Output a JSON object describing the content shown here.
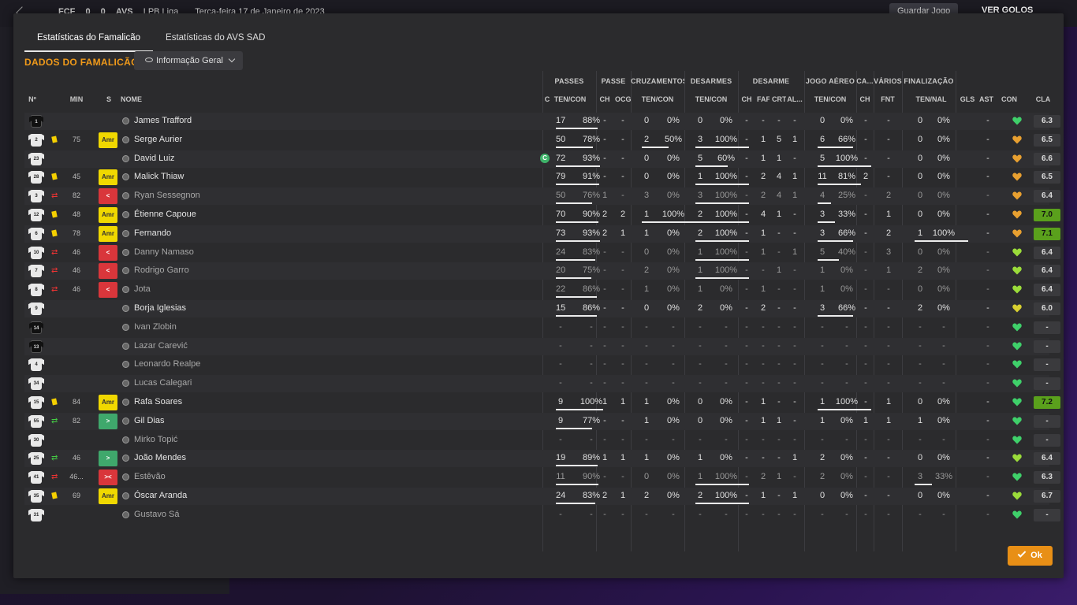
{
  "topbar": {
    "home": "FCF",
    "score_home": "0",
    "score_away": "0",
    "away": "AVS",
    "competition": "LPB Liga",
    "date": "Terça-feira 17 de Janeiro de 2023",
    "save_label": "Guardar Jogo",
    "goals_label": "VER GOLOS"
  },
  "tabs": [
    {
      "label": "Estatísticas do Famalicão"
    },
    {
      "label": "Estatísticas do AVS SAD"
    }
  ],
  "section_title": "DADOS DO FAMALICÃO",
  "view_dropdown": "Informação Geral",
  "groups": [
    "PASSES",
    "PASSE",
    "CRUZAMENTOS",
    "DESARMES",
    "DESARME",
    "JOGO AÉREO",
    "CA...",
    "VÁRIOS",
    "FINALIZAÇÃO"
  ],
  "headers": [
    "Nº",
    "MIN",
    "S",
    "NOME",
    "C",
    "TEN/CON",
    "CH",
    "OCG",
    "TEN/CON",
    "TEN/CON",
    "CH",
    "FAF",
    "CRT",
    "AL...",
    "TEN/CON",
    "CH",
    "FNT",
    "TEN/NAL",
    "GLS",
    "AST",
    "CON",
    "CLA"
  ],
  "players": [
    {
      "num": "1",
      "gk": true,
      "min": "",
      "yellow": false,
      "sub": "",
      "badge": "",
      "badge_label": "",
      "name": "James Trafford",
      "dim": false,
      "captain": false,
      "c": [
        "17",
        "88%",
        "-",
        "-",
        "0",
        "0%",
        "0",
        "0%",
        "-",
        "-",
        "-",
        "-",
        "0",
        "0%",
        "-",
        "-",
        "0",
        "0%",
        "-"
      ],
      "con": "green",
      "cla": "6.3",
      "good": false,
      "pass_ratio": 0.88,
      "cross_ratio": 0,
      "tack_ratio": 0,
      "air_ratio": 0,
      "fin_ratio": 0
    },
    {
      "num": "2",
      "gk": false,
      "min": "75",
      "yellow": true,
      "sub": "",
      "badge": "amr",
      "badge_label": "Amr",
      "name": "Serge Aurier",
      "dim": false,
      "captain": false,
      "c": [
        "50",
        "78%",
        "-",
        "-",
        "2",
        "50%",
        "3",
        "100%",
        "-",
        "1",
        "5",
        "1",
        "6",
        "66%",
        "-",
        "-",
        "0",
        "0%",
        "-"
      ],
      "con": "orange",
      "cla": "6.5",
      "good": false,
      "pass_ratio": 0.78,
      "cross_ratio": 0.5,
      "tack_ratio": 1,
      "air_ratio": 0.66,
      "fin_ratio": 0
    },
    {
      "num": "23",
      "gk": false,
      "min": "",
      "yellow": false,
      "sub": "",
      "badge": "",
      "badge_label": "",
      "name": "David Luiz",
      "dim": false,
      "captain": true,
      "captain_label": "C",
      "c": [
        "72",
        "93%",
        "-",
        "-",
        "0",
        "0%",
        "5",
        "60%",
        "-",
        "1",
        "1",
        "-",
        "5",
        "100%",
        "-",
        "-",
        "0",
        "0%",
        "-"
      ],
      "con": "orange",
      "cla": "6.6",
      "good": false,
      "pass_ratio": 0.93,
      "cross_ratio": 0,
      "tack_ratio": 0.6,
      "air_ratio": 1,
      "fin_ratio": 0
    },
    {
      "num": "28",
      "gk": false,
      "min": "45",
      "yellow": true,
      "sub": "",
      "badge": "amr",
      "badge_label": "Amr",
      "name": "Malick Thiaw",
      "dim": false,
      "captain": false,
      "c": [
        "79",
        "91%",
        "-",
        "-",
        "0",
        "0%",
        "1",
        "100%",
        "-",
        "2",
        "4",
        "1",
        "11",
        "81%",
        "2",
        "-",
        "0",
        "0%",
        "-"
      ],
      "con": "orange",
      "cla": "6.5",
      "good": false,
      "pass_ratio": 0.91,
      "cross_ratio": 0,
      "tack_ratio": 1,
      "air_ratio": 0.81,
      "fin_ratio": 0
    },
    {
      "num": "3",
      "gk": false,
      "min": "82",
      "yellow": false,
      "sub": "out",
      "badge": "out",
      "badge_label": "<",
      "name": "Ryan Sessegnon",
      "dim": true,
      "captain": false,
      "c": [
        "50",
        "76%",
        "1",
        "-",
        "3",
        "0%",
        "3",
        "100%",
        "-",
        "2",
        "4",
        "1",
        "4",
        "25%",
        "-",
        "2",
        "0",
        "0%",
        "-"
      ],
      "con": "orange",
      "cla": "6.4",
      "good": false,
      "pass_ratio": 0.76,
      "cross_ratio": 0,
      "tack_ratio": 1,
      "air_ratio": 0.25,
      "fin_ratio": 0
    },
    {
      "num": "12",
      "gk": false,
      "min": "48",
      "yellow": true,
      "sub": "",
      "badge": "amr",
      "badge_label": "Amr",
      "name": "Étienne Capoue",
      "dim": false,
      "captain": false,
      "c": [
        "70",
        "90%",
        "2",
        "2",
        "1",
        "100%",
        "2",
        "100%",
        "-",
        "4",
        "1",
        "-",
        "3",
        "33%",
        "-",
        "1",
        "0",
        "0%",
        "-"
      ],
      "con": "orange",
      "cla": "7.0",
      "good": true,
      "pass_ratio": 0.9,
      "cross_ratio": 1,
      "tack_ratio": 1,
      "air_ratio": 0.33,
      "fin_ratio": 0
    },
    {
      "num": "6",
      "gk": false,
      "min": "78",
      "yellow": true,
      "sub": "",
      "badge": "amr",
      "badge_label": "Amr",
      "name": "Fernando",
      "dim": false,
      "captain": false,
      "c": [
        "73",
        "93%",
        "2",
        "1",
        "1",
        "0%",
        "2",
        "100%",
        "-",
        "1",
        "-",
        "-",
        "3",
        "66%",
        "-",
        "2",
        "1",
        "100%",
        "-"
      ],
      "con": "orange",
      "cla": "7.1",
      "good": true,
      "pass_ratio": 0.93,
      "cross_ratio": 0,
      "tack_ratio": 1,
      "air_ratio": 0.66,
      "fin_ratio": 1
    },
    {
      "num": "10",
      "gk": false,
      "min": "46",
      "yellow": false,
      "sub": "out",
      "badge": "out",
      "badge_label": "<",
      "name": "Danny Namaso",
      "dim": true,
      "captain": false,
      "c": [
        "24",
        "83%",
        "-",
        "-",
        "0",
        "0%",
        "1",
        "100%",
        "-",
        "1",
        "-",
        "1",
        "5",
        "40%",
        "-",
        "3",
        "0",
        "0%",
        "-"
      ],
      "con": "lime",
      "cla": "6.4",
      "good": false,
      "pass_ratio": 0.83,
      "cross_ratio": 0,
      "tack_ratio": 1,
      "air_ratio": 0.4,
      "fin_ratio": 0
    },
    {
      "num": "7",
      "gk": false,
      "min": "46",
      "yellow": false,
      "sub": "out",
      "badge": "out",
      "badge_label": "<",
      "name": "Rodrigo Garro",
      "dim": true,
      "captain": false,
      "c": [
        "20",
        "75%",
        "-",
        "-",
        "2",
        "0%",
        "1",
        "100%",
        "-",
        "-",
        "1",
        "-",
        "1",
        "0%",
        "-",
        "1",
        "2",
        "0%",
        "-"
      ],
      "con": "lime",
      "cla": "6.4",
      "good": false,
      "pass_ratio": 0.75,
      "cross_ratio": 0,
      "tack_ratio": 1,
      "air_ratio": 0,
      "fin_ratio": 0
    },
    {
      "num": "8",
      "gk": false,
      "min": "46",
      "yellow": false,
      "sub": "out",
      "badge": "out",
      "badge_label": "<",
      "name": "Jota",
      "dim": true,
      "captain": false,
      "c": [
        "22",
        "86%",
        "-",
        "-",
        "1",
        "0%",
        "1",
        "0%",
        "-",
        "1",
        "-",
        "-",
        "1",
        "0%",
        "-",
        "-",
        "0",
        "0%",
        "-"
      ],
      "con": "lime",
      "cla": "6.4",
      "good": false,
      "pass_ratio": 0.86,
      "cross_ratio": 0,
      "tack_ratio": 0,
      "air_ratio": 0,
      "fin_ratio": 0
    },
    {
      "num": "9",
      "gk": false,
      "min": "",
      "yellow": false,
      "sub": "",
      "badge": "",
      "badge_label": "",
      "name": "Borja Iglesias",
      "dim": false,
      "captain": false,
      "c": [
        "15",
        "86%",
        "-",
        "-",
        "0",
        "0%",
        "2",
        "0%",
        "-",
        "2",
        "-",
        "-",
        "3",
        "66%",
        "-",
        "-",
        "2",
        "0%",
        "-"
      ],
      "con": "yellow",
      "cla": "6.0",
      "good": false,
      "pass_ratio": 0.86,
      "cross_ratio": 0,
      "tack_ratio": 0,
      "air_ratio": 0.66,
      "fin_ratio": 0
    },
    {
      "num": "14",
      "gk": true,
      "min": "",
      "yellow": false,
      "sub": "",
      "badge": "",
      "badge_label": "",
      "name": "Ivan Zlobin",
      "dim": true,
      "captain": false,
      "c": [
        "-",
        "-",
        "-",
        "-",
        "-",
        "-",
        "-",
        "-",
        "-",
        "-",
        "-",
        "-",
        "-",
        "-",
        "-",
        "-",
        "-",
        "-",
        "-"
      ],
      "con": "green",
      "cla": "-",
      "good": false,
      "pass_ratio": 0,
      "cross_ratio": 0,
      "tack_ratio": 0,
      "air_ratio": 0,
      "fin_ratio": 0
    },
    {
      "num": "13",
      "gk": true,
      "min": "",
      "yellow": false,
      "sub": "",
      "badge": "",
      "badge_label": "",
      "name": "Lazar Carević",
      "dim": true,
      "captain": false,
      "c": [
        "-",
        "-",
        "-",
        "-",
        "-",
        "-",
        "-",
        "-",
        "-",
        "-",
        "-",
        "-",
        "-",
        "-",
        "-",
        "-",
        "-",
        "-",
        "-"
      ],
      "con": "green",
      "cla": "-",
      "good": false,
      "pass_ratio": 0,
      "cross_ratio": 0,
      "tack_ratio": 0,
      "air_ratio": 0,
      "fin_ratio": 0
    },
    {
      "num": "4",
      "gk": false,
      "min": "",
      "yellow": false,
      "sub": "",
      "badge": "",
      "badge_label": "",
      "name": "Leonardo Realpe",
      "dim": true,
      "captain": false,
      "c": [
        "-",
        "-",
        "-",
        "-",
        "-",
        "-",
        "-",
        "-",
        "-",
        "-",
        "-",
        "-",
        "-",
        "-",
        "-",
        "-",
        "-",
        "-",
        "-"
      ],
      "con": "green",
      "cla": "-",
      "good": false,
      "pass_ratio": 0,
      "cross_ratio": 0,
      "tack_ratio": 0,
      "air_ratio": 0,
      "fin_ratio": 0
    },
    {
      "num": "34",
      "gk": false,
      "min": "",
      "yellow": false,
      "sub": "",
      "badge": "",
      "badge_label": "",
      "name": "Lucas Calegari",
      "dim": true,
      "captain": false,
      "c": [
        "-",
        "-",
        "-",
        "-",
        "-",
        "-",
        "-",
        "-",
        "-",
        "-",
        "-",
        "-",
        "-",
        "-",
        "-",
        "-",
        "-",
        "-",
        "-"
      ],
      "con": "green",
      "cla": "-",
      "good": false,
      "pass_ratio": 0,
      "cross_ratio": 0,
      "tack_ratio": 0,
      "air_ratio": 0,
      "fin_ratio": 0
    },
    {
      "num": "15",
      "gk": false,
      "min": "84",
      "yellow": true,
      "sub": "",
      "badge": "amr",
      "badge_label": "Amr",
      "name": "Rafa Soares",
      "dim": false,
      "captain": false,
      "c": [
        "9",
        "100%",
        "1",
        "1",
        "1",
        "0%",
        "0",
        "0%",
        "-",
        "1",
        "-",
        "-",
        "1",
        "100%",
        "-",
        "1",
        "0",
        "0%",
        "-"
      ],
      "con": "green",
      "cla": "7.2",
      "good": true,
      "pass_ratio": 1,
      "cross_ratio": 0,
      "tack_ratio": 0,
      "air_ratio": 1,
      "fin_ratio": 0
    },
    {
      "num": "55",
      "gk": false,
      "min": "82",
      "yellow": false,
      "sub": "in",
      "badge": "in",
      "badge_label": ">",
      "name": "Gil Dias",
      "dim": false,
      "captain": false,
      "c": [
        "9",
        "77%",
        "-",
        "-",
        "1",
        "0%",
        "0",
        "0%",
        "-",
        "1",
        "1",
        "-",
        "1",
        "0%",
        "1",
        "1",
        "1",
        "0%",
        "-"
      ],
      "con": "green",
      "cla": "-",
      "good": false,
      "pass_ratio": 0.77,
      "cross_ratio": 0,
      "tack_ratio": 0,
      "air_ratio": 0,
      "fin_ratio": 0
    },
    {
      "num": "30",
      "gk": false,
      "min": "",
      "yellow": false,
      "sub": "",
      "badge": "",
      "badge_label": "",
      "name": "Mirko Topić",
      "dim": true,
      "captain": false,
      "c": [
        "-",
        "-",
        "-",
        "-",
        "-",
        "-",
        "-",
        "-",
        "-",
        "-",
        "-",
        "-",
        "-",
        "-",
        "-",
        "-",
        "-",
        "-",
        "-"
      ],
      "con": "green",
      "cla": "-",
      "good": false,
      "pass_ratio": 0,
      "cross_ratio": 0,
      "tack_ratio": 0,
      "air_ratio": 0,
      "fin_ratio": 0
    },
    {
      "num": "25",
      "gk": false,
      "min": "46",
      "yellow": false,
      "sub": "in",
      "badge": "in",
      "badge_label": ">",
      "name": "João Mendes",
      "dim": false,
      "captain": false,
      "c": [
        "19",
        "89%",
        "1",
        "1",
        "1",
        "0%",
        "1",
        "0%",
        "-",
        "-",
        "-",
        "1",
        "2",
        "0%",
        "-",
        "-",
        "0",
        "0%",
        "-"
      ],
      "con": "lime",
      "cla": "6.4",
      "good": false,
      "pass_ratio": 0.89,
      "cross_ratio": 0,
      "tack_ratio": 0,
      "air_ratio": 0,
      "fin_ratio": 0
    },
    {
      "num": "41",
      "gk": false,
      "min": "46...",
      "yellow": false,
      "sub": "out",
      "badge": "both",
      "badge_label": "><",
      "name": "Estêvão",
      "dim": true,
      "captain": false,
      "c": [
        "11",
        "90%",
        "-",
        "-",
        "0",
        "0%",
        "1",
        "100%",
        "-",
        "2",
        "1",
        "-",
        "2",
        "0%",
        "-",
        "-",
        "3",
        "33%",
        "-"
      ],
      "con": "green",
      "cla": "6.3",
      "good": false,
      "pass_ratio": 0.9,
      "cross_ratio": 0,
      "tack_ratio": 1,
      "air_ratio": 0,
      "fin_ratio": 0.33
    },
    {
      "num": "35",
      "gk": false,
      "min": "69",
      "yellow": true,
      "sub": "",
      "badge": "amr",
      "badge_label": "Amr",
      "name": "Óscar Aranda",
      "dim": false,
      "captain": false,
      "c": [
        "24",
        "83%",
        "2",
        "1",
        "2",
        "0%",
        "2",
        "100%",
        "-",
        "1",
        "-",
        "1",
        "0",
        "0%",
        "-",
        "-",
        "0",
        "0%",
        "-"
      ],
      "con": "lime",
      "cla": "6.7",
      "good": false,
      "pass_ratio": 0.83,
      "cross_ratio": 0,
      "tack_ratio": 1,
      "air_ratio": 0,
      "fin_ratio": 0
    },
    {
      "num": "31",
      "gk": false,
      "min": "",
      "yellow": false,
      "sub": "",
      "badge": "",
      "badge_label": "",
      "name": "Gustavo Sá",
      "dim": true,
      "captain": false,
      "c": [
        "-",
        "-",
        "-",
        "-",
        "-",
        "-",
        "-",
        "-",
        "-",
        "-",
        "-",
        "-",
        "-",
        "-",
        "-",
        "-",
        "-",
        "-",
        "-"
      ],
      "con": "green",
      "cla": "-",
      "good": false,
      "pass_ratio": 0,
      "cross_ratio": 0,
      "tack_ratio": 0,
      "air_ratio": 0,
      "fin_ratio": 0
    }
  ],
  "colors": {
    "accent": "#f09a1a",
    "green": "#3fd06a",
    "lime": "#9bdc3a",
    "orange": "#e8a030",
    "yellow": "#d8d030"
  },
  "ok_label": "Ok"
}
